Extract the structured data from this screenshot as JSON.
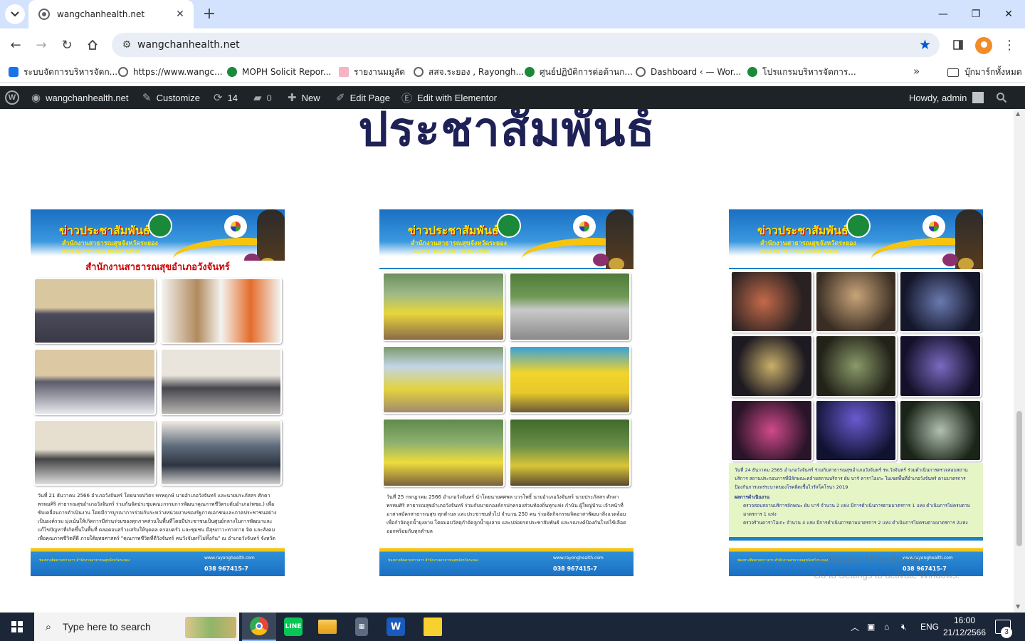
{
  "browser": {
    "tab_title": "wangchanhealth.net",
    "tab_close": "✕",
    "new_tab": "+",
    "url": "wangchanhealth.net",
    "window_controls": {
      "minimize": "—",
      "maximize": "❐",
      "close": "✕"
    }
  },
  "bookmarks": {
    "items": [
      {
        "label": "ระบบจัดการบริหารจัดก...",
        "icon": "puzzle-icon",
        "color": "#1a73e8"
      },
      {
        "label": "https://www.wangc...",
        "icon": "globe-icon",
        "color": "#5f6368"
      },
      {
        "label": "MOPH Solicit Repor...",
        "icon": "moph-icon",
        "color": "#1a8a3a"
      },
      {
        "label": "รายงานมมูลัด",
        "icon": "chart-icon",
        "color": "#d93025"
      },
      {
        "label": "สสจ.ระยอง , Rayongh...",
        "icon": "globe-icon",
        "color": "#5f6368"
      },
      {
        "label": "ศูนย์ปฏิบัติการต่อต้านก...",
        "icon": "moph-icon",
        "color": "#1a8a3a"
      },
      {
        "label": "Dashboard ‹ — Wor...",
        "icon": "globe-icon",
        "color": "#5f6368"
      },
      {
        "label": "โปรแกรมบริหารจัดการ...",
        "icon": "moph-icon",
        "color": "#1a8a3a"
      }
    ],
    "more": "»",
    "all_bookmarks": "บุ๊กมาร์กทั้งหมด"
  },
  "adminbar": {
    "site_name": "wangchanhealth.net",
    "customize": "Customize",
    "updates_count": "14",
    "comments_count": "0",
    "new_label": "New",
    "edit_page": "Edit Page",
    "edit_elementor": "Edit with Elementor",
    "howdy": "Howdy, admin"
  },
  "page": {
    "heading": "ประชาสัมพันธ์",
    "cards": [
      {
        "title": "ข่าวประชาสัมพันธ์",
        "office": "สำนักงานสาธารณสุขจังหวัดระยอง",
        "office_en": "Rayong Provincial Health Office",
        "banner": "สำนักงานสาธารณสุขอำเภอวังจันทร์",
        "body": "วันที่ 21 ธันวาคม 2566 อำเภอวังจันทร์ โดยนายปวิตร พรพฤกษ์ นายอำเภอวังจันทร์ และนายประภัสสร ศักดาพรหมศิริ สาธารณสุขอำเภอวังจันทร์ ร่วมกันจัดประชุมคณะกรรมการพัฒนาคุณภาพชีวิตระดับอำเภอ(พชอ.) เพื่อขับเคลื่อนการดำเนินงาน โดยมีการบูรณาการร่วมกันระหว่างหน่วยงานของรัฐภาคเอกชนและภาคประชาชนอย่างเป็นองค์รวม มุ่งเน้นให้เกิดการมีส่วนร่วมของทุกภาคส่วนในพื้นที่โดยมีประชาชนเป็นศูนย์กลางในการพัฒนาและแก้ไขปัญหาที่เกิดขึ้นในพื้นที่ ตลอดจนสร้างเสริมให้บุคคล ครอบครัว และชุมชน มีสุขภาวะทางกาย จิต และสังคม เพื่อคุณภาพชีวิตที่ดี ภายใต้ยุทธศาสตร์ \"คุณภาพชีวิตที่ดีวังจันทร์ คนวังจันทร์ไม่ทิ้งกัน\" ณ อำเภอวังจันทร์ จังหวัดระยอง",
        "footer": "ช่องทางติดตามข่าวสาร สำนักงานสาธารณสุขจังหวัดระยอง",
        "website": "www.rayonghealth.com",
        "phone": "038 967415-7"
      },
      {
        "title": "ข่าวประชาสัมพันธ์",
        "office": "สำนักงานสาธารณสุขจังหวัดระยอง",
        "office_en": "Rayong Provincial Health Office",
        "body": "วันที่ 25 กรกฎาคม 2566 อำเภอวังจันทร์ นำโดยนายศศพล บวรโพธิ์ นายอำเภอวังจันทร์ นายประภัสสร ศักดาพรหมศิริ สาธารณสุขอำเภอวังจันทร์ ร่วมกับนายกองค์กรปกครองส่วนท้องถิ่นทุกแห่ง กำนัน ผู้ใหญ่บ้าน เจ้าหน้าที่ อาสาสมัครสาธารณสุข ทุกตำบล และประชาชนทั่วไป จำนวน 250 คน ร่วมจัดกิจกรรมจิตอาสาพัฒนาสิ่งแวดล้อม เพื่อกำจัดลูกน้ำยุงลาย โดยมอบวัสดุกำจัดลูกน้ำยุงลาย และปล่อยรถประชาสัมพันธ์ และรณรงค์ป้องกันโรคไข้เลือดออกพร้อมกันทุกตำบล",
        "footer": "ช่องทางติดตามข่าวสาร สำนักงานสาธารณสุขจังหวัดระยอง",
        "website": "www.rayonghealth.com",
        "phone": "038 967415-7"
      },
      {
        "title": "ข่าวประชาสัมพันธ์",
        "office": "สำนักงานสาธารณสุขจังหวัดระยอง",
        "office_en": "Rayong Provincial Health Office",
        "body": "วันที่ 24 ธันวาคม 2565 อำเภอวังจันทร์ ร่วมกับสาธารณสุขอำเภอวังจันทร์ รพ.วังจันทร์ ร่วมดำเนินการตรวจสอบสถานบริการ สถานประกอบการที่มีลักษณะคล้ายสถานบริการ ผับ บาร์ คาราโอเกะ ในเขตพื้นที่อำเภอวังจันทร์ ตามมาตรการป้องกันการแพร่ระบาดของโรคติดเชื้อไวรัสโคโรนา 2019",
        "result_title": "ผลการดำเนินงาน",
        "result_1": "ตรวจสอบสถานบริการลักษณะ ผับ บาร์ จำนวน 2 แห่ง มีการดำเนินการตามมาตรการ 1 แห่ง ดำเนินการไม่ครบตามมาตรการ 1 แห่ง",
        "result_2": "ตรวจร้านคาราโอเกะ จำนวน 4 แห่ง มีการดำเนินการตามมาตรการ 2 แห่ง ดำเนินการไม่ครบตามมาตรการ 2แห่ง",
        "footer": "ช่องทางติดตามข่าวสาร สำนักงานสาธารณสุขจังหวัดระยอง",
        "website": "www.rayonghealth.com",
        "phone": "038 967415-7"
      }
    ],
    "watermark_line1": "Activate Windows",
    "watermark_line2": "Go to Settings to activate Windows."
  },
  "taskbar": {
    "search_placeholder": "Type here to search",
    "apps": [
      {
        "name": "Chrome",
        "icon": "chrome-icon",
        "color": "#e8453c"
      },
      {
        "name": "LINE",
        "icon": "line-icon",
        "color": "#06c755"
      },
      {
        "name": "File Explorer",
        "icon": "folder-icon",
        "color": "#f2b632"
      },
      {
        "name": "Calculator",
        "icon": "calculator-icon",
        "color": "#5c6b7f"
      },
      {
        "name": "Word",
        "icon": "word-icon",
        "color": "#185abd"
      },
      {
        "name": "Sticky Notes",
        "icon": "sticky-notes-icon",
        "color": "#f7d12e"
      }
    ],
    "language": "ENG",
    "time": "16:00",
    "date": "21/12/2566",
    "notifications": "3"
  }
}
